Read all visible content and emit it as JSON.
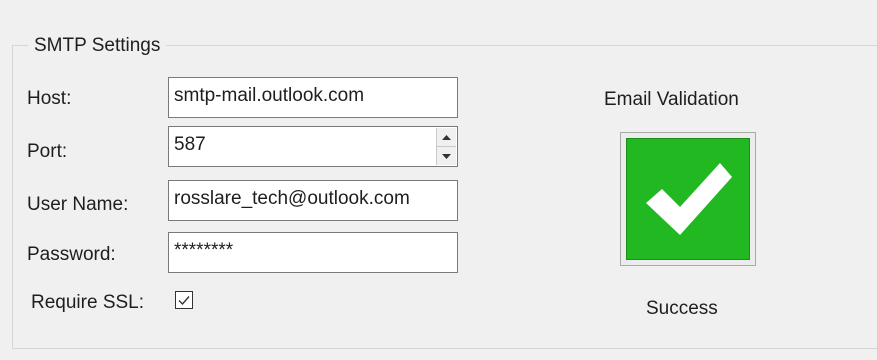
{
  "smtp": {
    "title": "SMTP Settings",
    "host": {
      "label": "Host:",
      "value": "smtp-mail.outlook.com"
    },
    "port": {
      "label": "Port:",
      "value": "587"
    },
    "user": {
      "label": "User Name:",
      "value": "rosslare_tech@outlook.com"
    },
    "password": {
      "label": "Password:",
      "value": "********"
    },
    "ssl": {
      "label": "Require SSL:",
      "checked": true
    }
  },
  "validation": {
    "title": "Email Validation",
    "status": "Success",
    "icon": "checkmark-icon",
    "color": "#22b822"
  }
}
